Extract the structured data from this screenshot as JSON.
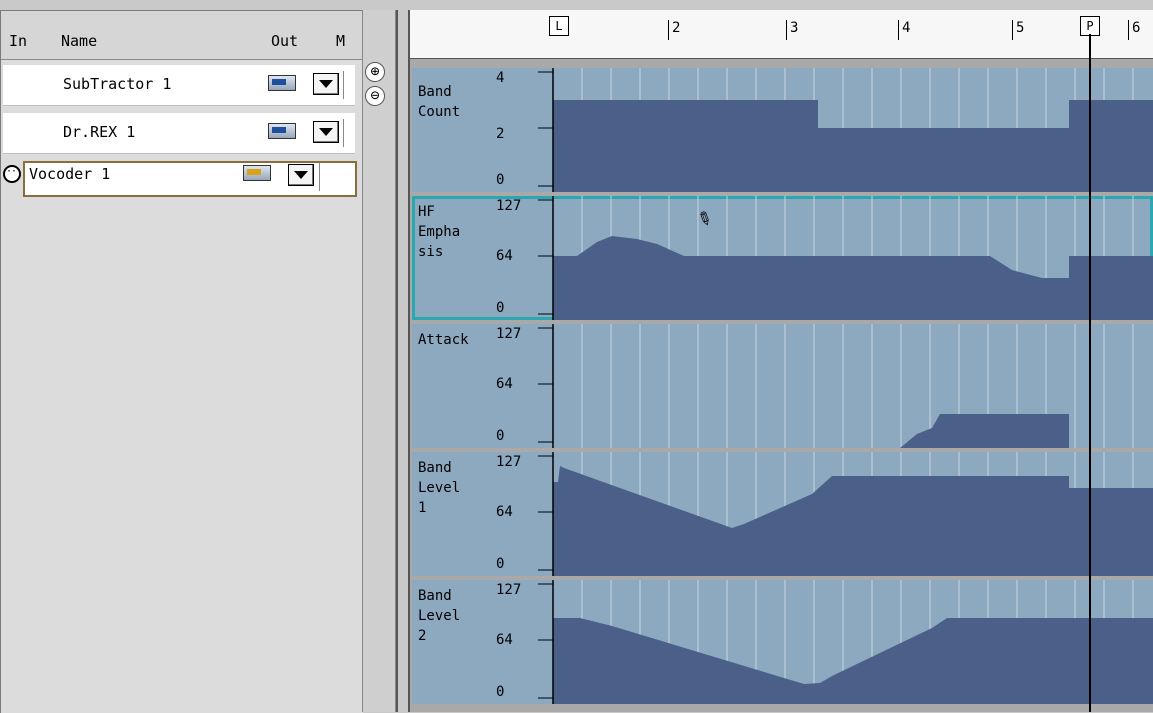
{
  "tracklist": {
    "headers": {
      "in": "In",
      "name": "Name",
      "out": "Out",
      "m": "M"
    },
    "tracks": [
      {
        "name": "SubTractor 1"
      },
      {
        "name": "Dr.REX 1"
      },
      {
        "name": "Vocoder 1"
      }
    ]
  },
  "zoom": {
    "in_label": "⊕",
    "out_label": "⊖"
  },
  "ruler": {
    "bars": [
      "2",
      "3",
      "4",
      "5",
      "6"
    ],
    "left_locator": "L",
    "position_marker": "P"
  },
  "lanes": [
    {
      "name": "Band\nCount",
      "ticks": [
        "4",
        "2",
        "0"
      ]
    },
    {
      "name": "HF\nEmpha\nsis",
      "ticks": [
        "127",
        "64",
        "0"
      ]
    },
    {
      "name": "Attack",
      "ticks": [
        "127",
        "64",
        "0"
      ]
    },
    {
      "name": "Band\nLevel\n1",
      "ticks": [
        "127",
        "64",
        "0"
      ]
    },
    {
      "name": "Band\nLevel\n2",
      "ticks": [
        "127",
        "64",
        "0"
      ]
    }
  ],
  "colors": {
    "lane_bg": "#8da9c0",
    "curve_fill": "#4a6088",
    "selection": "#2aa7b0"
  }
}
